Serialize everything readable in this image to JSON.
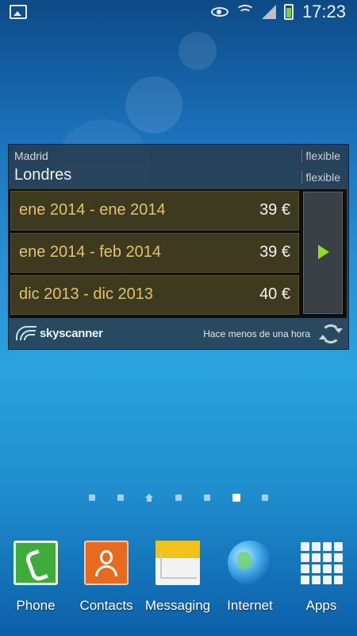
{
  "status_bar": {
    "time": "17:23",
    "icons": [
      "image-icon",
      "eye-icon",
      "wifi-icon",
      "signal-icon",
      "battery-icon"
    ]
  },
  "widget": {
    "origin": "Madrid",
    "destination": "Londres",
    "origin_flex": "flexible",
    "destination_flex": "flexible",
    "results": [
      {
        "dates": "ene 2014 - ene 2014",
        "price": "39 €"
      },
      {
        "dates": "ene 2014 - feb 2014",
        "price": "39 €"
      },
      {
        "dates": "dic 2013 - dic 2013",
        "price": "40 €"
      }
    ],
    "brand": "skyscanner",
    "updated": "Hace menos de una hora"
  },
  "page_indicator": {
    "count": 7,
    "home_index": 2,
    "active_index": 5
  },
  "dock": [
    {
      "label": "Phone",
      "icon": "phone-icon"
    },
    {
      "label": "Contacts",
      "icon": "contacts-icon"
    },
    {
      "label": "Messaging",
      "icon": "messaging-icon"
    },
    {
      "label": "Internet",
      "icon": "internet-icon"
    },
    {
      "label": "Apps",
      "icon": "apps-grid-icon"
    }
  ],
  "colors": {
    "price_accent": "#e3c06a",
    "play_green": "#8ee01e",
    "battery_green": "#7bd33c"
  }
}
